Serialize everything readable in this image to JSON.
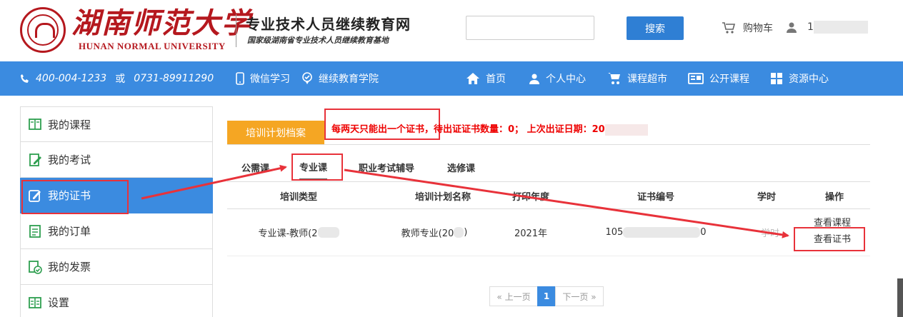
{
  "header": {
    "logo_cn": "湖南师范大学",
    "logo_en": "HUNAN NORMAL UNIVERSITY",
    "site_title": "专业技术人员继续教育网",
    "site_subtitle": "国家级湖南省专业技术人员继续教育基地",
    "search_placeholder": "",
    "search_button": "搜索",
    "cart_label": "购物车",
    "user_prefix": "1"
  },
  "navbar": {
    "phone1": "400-004-1233",
    "or": "或",
    "phone2": "0731-89911290",
    "wechat": "微信学习",
    "college": "继续教育学院",
    "items": [
      "首页",
      "个人中心",
      "课程超市",
      "公开课程",
      "资源中心"
    ]
  },
  "sidebar": {
    "items": [
      "我的课程",
      "我的考试",
      "我的证书",
      "我的订单",
      "我的发票",
      "设置"
    ],
    "active_index": 2
  },
  "panel": {
    "tab_title": "培训计划档案",
    "notice_text": "每两天只能出一个证书，待出证证书数量：0； 上次出证日期：20"
  },
  "subtabs": [
    "公需课",
    "专业课",
    "职业考试辅导",
    "选修课"
  ],
  "table": {
    "headers": [
      "培训类型",
      "培训计划名称",
      "打印年度",
      "证书编号",
      "学时",
      "操作"
    ],
    "row": {
      "type_prefix": "专业课-教师(2",
      "plan_prefix": "教师专业(20",
      "plan_suffix": ")",
      "year": "2021年",
      "cert_prefix": "105",
      "cert_suffix": "0",
      "hours_fragment": "学时",
      "op1": "查看课程",
      "op2": "查看证书"
    }
  },
  "pager": {
    "prev": "« 上一页",
    "current": "1",
    "next": "下一页 »"
  },
  "colors": {
    "brand_red": "#b5181e",
    "nav_blue": "#3b8be0",
    "tab_orange": "#f5a623",
    "annotation_red": "#e8323a"
  }
}
